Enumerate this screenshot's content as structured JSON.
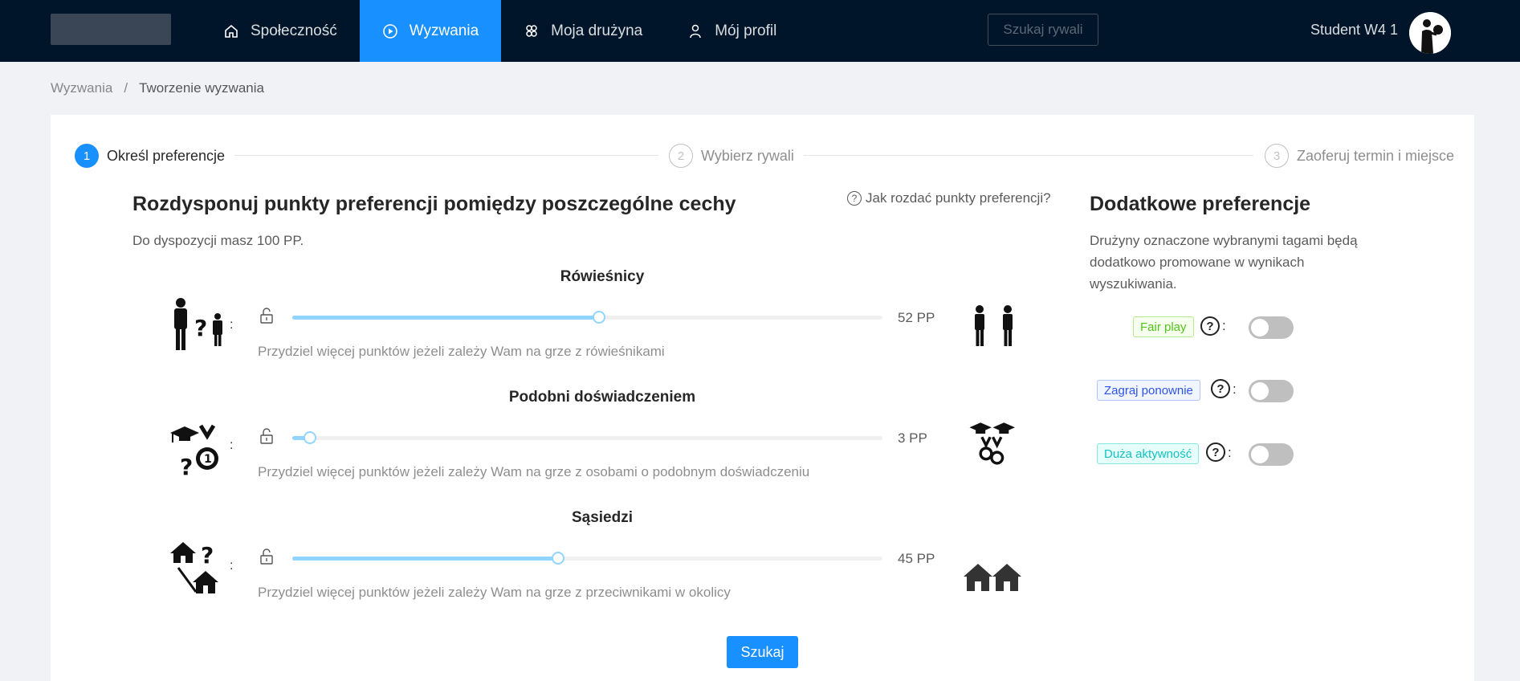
{
  "header": {
    "nav": [
      {
        "label": "Społeczność",
        "icon": "home-icon"
      },
      {
        "label": "Wyzwania",
        "icon": "play-circle-icon",
        "active": true
      },
      {
        "label": "Moja drużyna",
        "icon": "team-icon"
      },
      {
        "label": "Mój profil",
        "icon": "user-icon"
      }
    ],
    "search_label": "Szukaj rywali",
    "user_name": "Student W4 1"
  },
  "breadcrumb": [
    "Wyzwania",
    "/",
    "Tworzenie wyzwania"
  ],
  "steps": [
    {
      "num": "1",
      "title": "Określ preferencje",
      "status": "active"
    },
    {
      "num": "2",
      "title": "Wybierz rywali",
      "status": "wait"
    },
    {
      "num": "3",
      "title": "Zaoferuj termin i miejsce",
      "status": "wait"
    }
  ],
  "main": {
    "title": "Rozdysponuj punkty preferencji pomiędzy poszczególne cechy",
    "help": "Jak rozdać punkty preferencji?",
    "available": "Do dyspozycji masz 100 PP.",
    "prefs": [
      {
        "title": "Rówieśnicy",
        "value": 52,
        "value_label": "52 PP",
        "desc": "Przydziel więcej punktów jeżeli zależy Wam na grze z rówieśnikami",
        "colon": ":"
      },
      {
        "title": "Podobni doświadczeniem",
        "value": 3,
        "value_label": "3 PP",
        "desc": "Przydziel więcej punktów jeżeli zależy Wam na grze z osobami o podobnym doświadczeniu",
        "colon": ":"
      },
      {
        "title": "Sąsiedzi",
        "value": 45,
        "value_label": "45 PP",
        "desc": "Przydziel więcej punktów jeżeli zależy Wam na grze z przeciwnikami w okolicy",
        "colon": ":"
      }
    ],
    "submit_label": "Szukaj"
  },
  "additional": {
    "title": "Dodatkowe preferencje",
    "desc": "Drużyny oznaczone wybranymi tagami będą dodatkowo promowane w wynikach wyszukiwania.",
    "tags": [
      {
        "label": "Fair play",
        "color": "#52c41a",
        "enabled": false
      },
      {
        "label": "Zagraj ponownie",
        "color": "#2f54eb",
        "enabled": false
      },
      {
        "label": "Duża aktywność",
        "color": "#13c2c2",
        "enabled": false
      }
    ],
    "qmark": "?",
    "colon": ":"
  }
}
